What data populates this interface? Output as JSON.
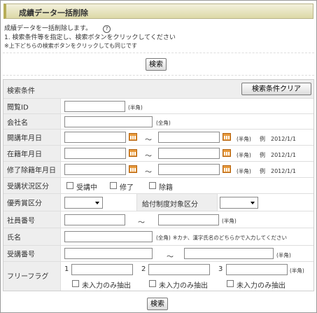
{
  "title": "成績データ一括削除",
  "intro": {
    "line1": "成績データを一括削除します。",
    "help_glyph": "?",
    "line2": "1. 検索条件等を指定し、検索ボタンをクリックしてください",
    "line3": "※上下どちらの検索ボタンをクリックしても同じです"
  },
  "search_button": "検索",
  "clear_button": "検索条件クリア",
  "conditions_header": "検索条件",
  "notes": {
    "halfwidth": "(半角)",
    "fullwidth": "(全角)",
    "example": "例　2012/1/1",
    "name_hint": "※カナ、漢字氏名のどちらかで入力してください",
    "tilde": "～"
  },
  "fields": {
    "view_id": "閲覧ID",
    "company": "会社名",
    "start_date": "開講年月日",
    "enroll_date": "在籍年月日",
    "completion_date": "修了除籍年月日",
    "status": "受講状況区分",
    "award": "優秀賞区分",
    "benefit": "給付制度対象区分",
    "employee_no": "社員番号",
    "name": "氏名",
    "student_no": "受講番号",
    "free_flag": "フリーフラグ"
  },
  "status_options": [
    "受講中",
    "修了",
    "除籍"
  ],
  "free_flags": [
    {
      "num": "1",
      "check": "未入力のみ抽出"
    },
    {
      "num": "2",
      "check": "未入力のみ抽出"
    },
    {
      "num": "3",
      "check": "未入力のみ抽出"
    }
  ],
  "colors": {
    "title_bg": "#dcd8a6",
    "label_bg": "#eeeeee",
    "calendar_icon": "#e89a3c"
  },
  "icons": {
    "calendar": "calendar-icon",
    "help": "help-icon",
    "dropdown": "chevron-down-icon"
  }
}
